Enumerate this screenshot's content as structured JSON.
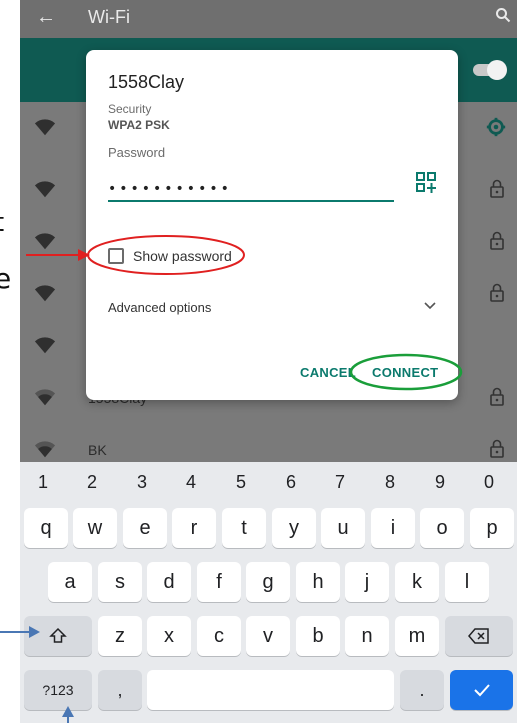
{
  "appbar": {
    "title": "Wi-Fi"
  },
  "networks": [
    {
      "name": "",
      "icon": "wifi-full-icon",
      "trailing": "gear-icon"
    },
    {
      "name": "",
      "icon": "wifi-full-icon",
      "trailing": "lock-icon"
    },
    {
      "name": "",
      "icon": "wifi-full-icon",
      "trailing": "lock-icon"
    },
    {
      "name": "",
      "icon": "wifi-full-icon",
      "trailing": "lock-icon"
    },
    {
      "name": "",
      "icon": "wifi-full-icon",
      "trailing": ""
    },
    {
      "name": "1558Clay",
      "icon": "wifi-medium-icon",
      "trailing": "lock-icon"
    },
    {
      "name": "BK",
      "icon": "wifi-medium-icon",
      "trailing": "lock-icon"
    }
  ],
  "dialog": {
    "title": "1558Clay",
    "security_label": "Security",
    "security_value": "WPA2 PSK",
    "password_label": "Password",
    "password_value": "•••••••••••",
    "show_password_label": "Show password",
    "show_password_checked": false,
    "advanced_label": "Advanced options",
    "cancel_label": "CANCEL",
    "connect_label": "CONNECT"
  },
  "keyboard": {
    "numbers": [
      "1",
      "2",
      "3",
      "4",
      "5",
      "6",
      "7",
      "8",
      "9",
      "0"
    ],
    "row1": [
      "q",
      "w",
      "e",
      "r",
      "t",
      "y",
      "u",
      "i",
      "o",
      "p"
    ],
    "row2": [
      "a",
      "s",
      "d",
      "f",
      "g",
      "h",
      "j",
      "k",
      "l"
    ],
    "row3": [
      "z",
      "x",
      "c",
      "v",
      "b",
      "n",
      "m"
    ],
    "symbols_label": "?123",
    "comma_label": ",",
    "period_label": ".",
    "enter_icon": "checkmark-icon",
    "shift_icon": "shift-icon",
    "backspace_icon": "backspace-icon"
  },
  "annotations": {
    "left_char_1": "t",
    "left_char_2": "e",
    "colors": {
      "red": "#e02020",
      "green": "#1a9e3a",
      "blue": "#4a77b4",
      "accent": "#0b7a6d"
    }
  }
}
